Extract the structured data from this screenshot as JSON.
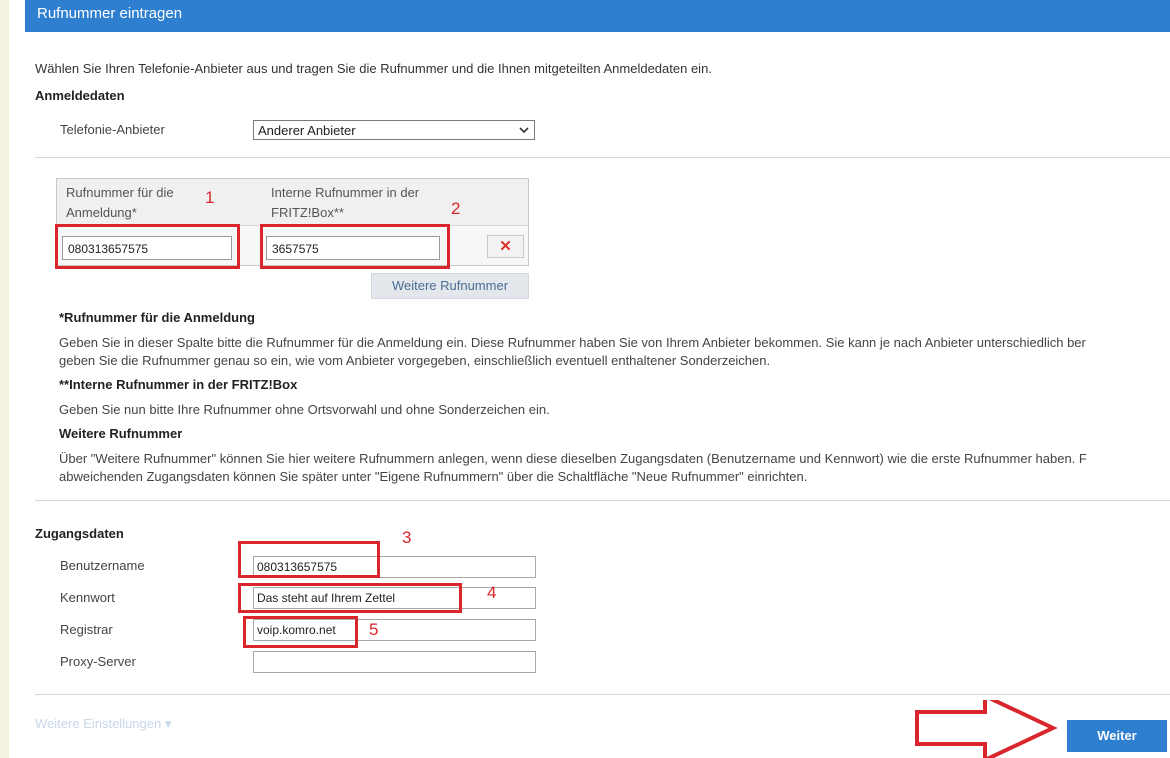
{
  "header": {
    "title": "Rufnummer eintragen"
  },
  "intro": "Wählen Sie Ihren Telefonie-Anbieter aus und tragen Sie die Rufnummer und die Ihnen mitgeteilten Anmeldedaten ein.",
  "anmeldedaten": {
    "heading": "Anmeldedaten",
    "provider_label": "Telefonie-Anbieter",
    "provider_value": "Anderer Anbieter"
  },
  "numbers_table": {
    "col1_header": "Rufnummer für die Anmeldung*",
    "col2_header": "Interne Rufnummer in der FRITZ!Box**",
    "row": {
      "login_number": "080313657575",
      "internal_number": "3657575",
      "delete_symbol": "✕"
    },
    "more_button": "Weitere Rufnummer"
  },
  "help": {
    "h1": "*Rufnummer für die Anmeldung",
    "p1": "Geben Sie in dieser Spalte bitte die Rufnummer für die Anmeldung ein. Diese Rufnummer haben Sie von Ihrem Anbieter bekommen. Sie kann je nach Anbieter unterschiedlich ber",
    "p1b": "geben Sie die Rufnummer genau so ein, wie vom Anbieter vorgegeben, einschließlich eventuell enthaltener Sonderzeichen.",
    "h2": "**Interne Rufnummer in der FRITZ!Box",
    "p2": "Geben Sie nun bitte Ihre Rufnummer ohne Ortsvorwahl und ohne Sonderzeichen ein.",
    "h3": "Weitere Rufnummer",
    "p3": "Über \"Weitere Rufnummer\" können Sie hier weitere Rufnummern anlegen, wenn diese dieselben Zugangsdaten (Benutzername und Kennwort) wie die erste Rufnummer haben. F",
    "p3b": "abweichenden Zugangsdaten können Sie später unter \"Eigene Rufnummern\" über die Schaltfläche \"Neue Rufnummer\" einrichten."
  },
  "zugangsdaten": {
    "heading": "Zugangsdaten",
    "username_label": "Benutzername",
    "username_value": "080313657575",
    "password_label": "Kennwort",
    "password_value": "Das steht auf Ihrem Zettel",
    "registrar_label": "Registrar",
    "registrar_value": "voip.komro.net",
    "proxy_label": "Proxy-Server",
    "proxy_value": ""
  },
  "annotations": {
    "n1": "1",
    "n2": "2",
    "n3": "3",
    "n4": "4",
    "n5": "5"
  },
  "footer": {
    "more_settings": "Weitere Einstellungen ▾",
    "next_button": "Weiter"
  },
  "colors": {
    "header_blue": "#2f7fd1",
    "annotation_red": "#d8262c"
  }
}
